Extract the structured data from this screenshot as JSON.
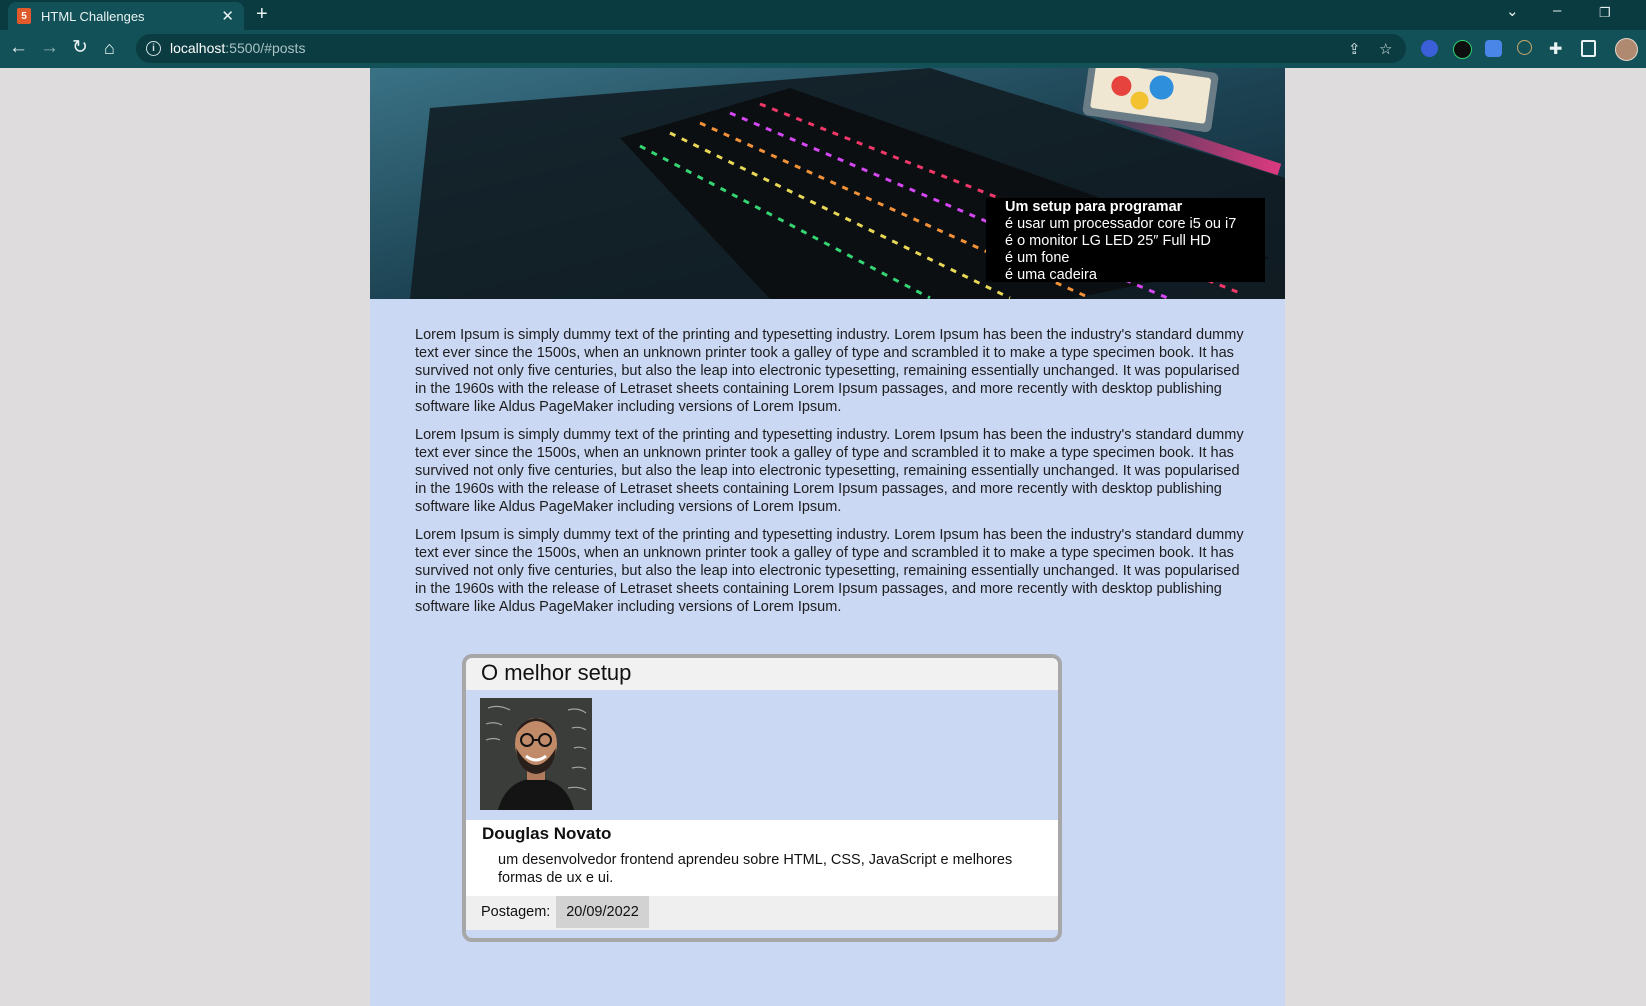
{
  "browser": {
    "tab_title": "HTML Challenges",
    "tab_close": "✕",
    "new_tab": "+",
    "url_host": "localhost",
    "url_path": ":5500/#posts",
    "favicon": "html5-icon"
  },
  "hero": {
    "caption_title": "Um setup para programar",
    "caption_lines": [
      "é usar um processador core i5 ou i7",
      "é o monitor LG LED 25″ Full HD",
      "é um fone",
      "é uma cadeira"
    ]
  },
  "article": {
    "paragraphs": [
      "Lorem Ipsum is simply dummy text of the printing and typesetting industry. Lorem Ipsum has been the industry's standard dummy text ever since the 1500s, when an unknown printer took a galley of type and scrambled it to make a type specimen book. It has survived not only five centuries, but also the leap into electronic typesetting, remaining essentially unchanged. It was popularised in the 1960s with the release of Letraset sheets containing Lorem Ipsum passages, and more recently with desktop publishing software like Aldus PageMaker including versions of Lorem Ipsum.",
      "Lorem Ipsum is simply dummy text of the printing and typesetting industry. Lorem Ipsum has been the industry's standard dummy text ever since the 1500s, when an unknown printer took a galley of type and scrambled it to make a type specimen book. It has survived not only five centuries, but also the leap into electronic typesetting, remaining essentially unchanged. It was popularised in the 1960s with the release of Letraset sheets containing Lorem Ipsum passages, and more recently with desktop publishing software like Aldus PageMaker including versions of Lorem Ipsum.",
      "Lorem Ipsum is simply dummy text of the printing and typesetting industry. Lorem Ipsum has been the industry's standard dummy text ever since the 1500s, when an unknown printer took a galley of type and scrambled it to make a type specimen book. It has survived not only five centuries, but also the leap into electronic typesetting, remaining essentially unchanged. It was popularised in the 1960s with the release of Letraset sheets containing Lorem Ipsum passages, and more recently with desktop publishing software like Aldus PageMaker including versions of Lorem Ipsum."
    ]
  },
  "card": {
    "title": "O melhor setup",
    "author": "Douglas Novato",
    "bio": "um desenvolvedor frontend aprendeu sobre HTML, CSS, JavaScript e melhores formas de ux e ui.",
    "post_label": "Postagem:",
    "post_date": "20/09/2022"
  },
  "colors": {
    "browser_frame": "#0a3b40",
    "toolbar": "#125158",
    "page_background": "#dedcdc",
    "content_background": "#cbd8f4",
    "caption_background": "#000000"
  }
}
